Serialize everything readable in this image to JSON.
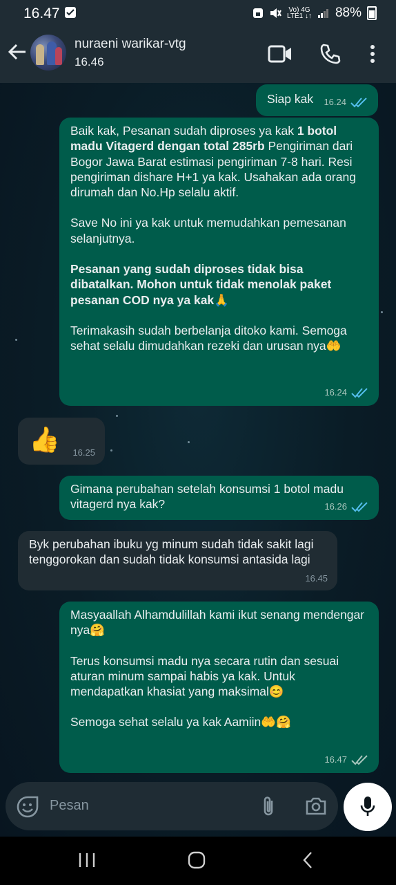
{
  "status_bar": {
    "time": "16.47",
    "network_top": "Vo) 4G",
    "network_bottom": "LTE1 ↓↑",
    "battery": "88%"
  },
  "header": {
    "contact_name": "nuraeni warikar-vtg",
    "subtitle": "16.46"
  },
  "messages": [
    {
      "dir": "out",
      "time": "16.24",
      "text": "Siap kak"
    },
    {
      "dir": "out",
      "time": "16.24",
      "p1_a": "Baik kak, Pesanan sudah diproses ya kak ",
      "p1_b": "1 botol madu Vitagerd dengan total 285rb",
      "p1_c": " Pengiriman dari Bogor Jawa Barat estimasi pengiriman 7-8  hari. Resi pengiriman dishare H+1 ya kak. Usahakan ada orang dirumah dan No.Hp selalu aktif.",
      "p2": "Save No ini ya kak untuk memudahkan pemesanan selanjutnya.",
      "p3": "Pesanan yang sudah  diproses tidak bisa dibatalkan. Mohon untuk tidak menolak paket pesanan COD nya ya kak🙏",
      "p4": "Terimakasih sudah berbelanja ditoko kami. Semoga sehat selalu dimudahkan rezeki dan urusan nya🤲"
    },
    {
      "dir": "in",
      "time": "16.25",
      "text": "👍"
    },
    {
      "dir": "out",
      "time": "16.26",
      "text": "Gimana perubahan setelah konsumsi 1 botol madu vitagerd nya kak?"
    },
    {
      "dir": "in",
      "time": "16.45",
      "text": "Byk perubahan ibuku yg minum sudah tidak sakit lagi tenggorokan dan sudah tidak konsumsi antasida lagi"
    },
    {
      "dir": "out",
      "time": "16.47",
      "p1": "Masyaallah Alhamdulillah kami ikut senang mendengar nya🤗",
      "p2": "Terus konsumsi madu nya secara rutin dan sesuai aturan minum sampai habis  ya kak. Untuk mendapatkan khasiat yang maksimal😊",
      "p3": "Semoga sehat selalu ya kak Aamiin🤲🤗"
    }
  ],
  "input": {
    "placeholder": "Pesan"
  },
  "icons": {
    "back": "arrow-left-icon",
    "video": "video-call-icon",
    "phone": "phone-icon",
    "menu": "more-vert-icon",
    "emoji": "sticker-icon",
    "attach": "paperclip-icon",
    "camera": "camera-icon",
    "mic": "mic-icon"
  },
  "colors": {
    "outgoing_bubble": "#005c4b",
    "incoming_bubble": "#202c33",
    "header": "#1f2c34",
    "read_tick": "#53bdeb"
  }
}
